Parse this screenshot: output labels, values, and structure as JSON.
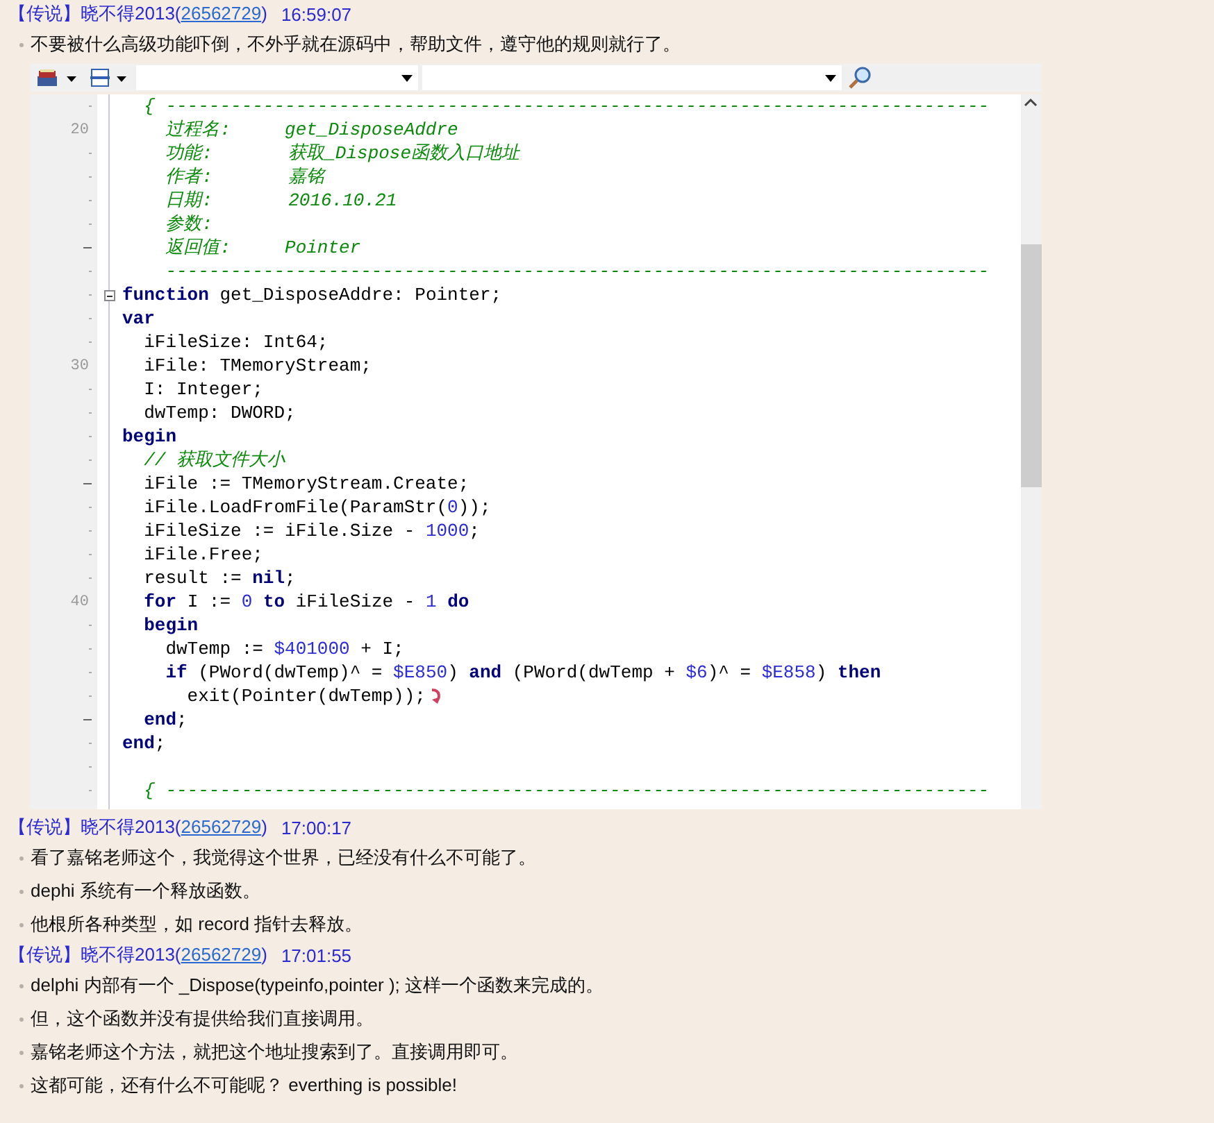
{
  "messages": [
    {
      "sender": {
        "prefix": "【传说】晓不得2013(",
        "qq": "26562729",
        "suffix": ")"
      },
      "time": "16:59:07",
      "items": [
        {
          "kind": "text",
          "text": "不要被什么高级功能吓倒，不外乎就在源码中，帮助文件，遵守他的规则就行了。"
        },
        {
          "kind": "code",
          "lines": [
            {
              "kind": "code",
              "tokens": [
                {
                  "kind": "comment",
                  "text": "  { ----------------------------------------------------------------------------"
                }
              ]
            },
            {
              "kind": "code",
              "number": "20",
              "tokens": [
                {
                  "kind": "comment",
                  "text": "    过程名:     get_DisposeAddre"
                }
              ]
            },
            {
              "kind": "code",
              "tokens": [
                {
                  "kind": "comment",
                  "text": "    功能:       获取_Dispose函数入口地址"
                }
              ]
            },
            {
              "kind": "code",
              "tokens": [
                {
                  "kind": "comment",
                  "text": "    作者:       嘉铭"
                }
              ]
            },
            {
              "kind": "code",
              "tokens": [
                {
                  "kind": "comment",
                  "text": "    日期:       2016.10.21"
                }
              ]
            },
            {
              "kind": "code",
              "tokens": [
                {
                  "kind": "comment",
                  "text": "    参数:"
                }
              ]
            },
            {
              "kind": "code",
              "block_end": true,
              "tokens": [
                {
                  "kind": "comment",
                  "text": "    返回值:     Pointer"
                }
              ]
            },
            {
              "kind": "code",
              "tokens": [
                {
                  "kind": "comment",
                  "text": "    ----------------------------------------------------------------------------"
                }
              ]
            },
            {
              "kind": "code",
              "collapsible": true,
              "tokens": [
                {
                  "kind": "keyword",
                  "text": "function"
                },
                {
                  "kind": "plain",
                  "text": " get_DisposeAddre: Pointer;"
                }
              ]
            },
            {
              "kind": "code",
              "tokens": [
                {
                  "kind": "keyword",
                  "text": "var"
                }
              ]
            },
            {
              "kind": "code",
              "tokens": [
                {
                  "kind": "plain",
                  "text": "  iFileSize: Int64;"
                }
              ]
            },
            {
              "kind": "code",
              "number": "30",
              "tokens": [
                {
                  "kind": "plain",
                  "text": "  iFile: TMemoryStream;"
                }
              ]
            },
            {
              "kind": "code",
              "tokens": [
                {
                  "kind": "plain",
                  "text": "  I: Integer;"
                }
              ]
            },
            {
              "kind": "code",
              "tokens": [
                {
                  "kind": "plain",
                  "text": "  dwTemp: DWORD;"
                }
              ]
            },
            {
              "kind": "code",
              "tokens": [
                {
                  "kind": "keyword",
                  "text": "begin"
                }
              ]
            },
            {
              "kind": "code",
              "tokens": [
                {
                  "kind": "comment",
                  "text": "  // 获取文件大小"
                }
              ]
            },
            {
              "kind": "code",
              "block_end": true,
              "tokens": [
                {
                  "kind": "plain",
                  "text": "  iFile := TMemoryStream.Create;"
                }
              ]
            },
            {
              "kind": "code",
              "tokens": [
                {
                  "kind": "plain",
                  "text": "  iFile.LoadFromFile(ParamStr("
                },
                {
                  "kind": "number",
                  "text": "0"
                },
                {
                  "kind": "plain",
                  "text": "));"
                }
              ]
            },
            {
              "kind": "code",
              "tokens": [
                {
                  "kind": "plain",
                  "text": "  iFileSize := iFile.Size - "
                },
                {
                  "kind": "number",
                  "text": "1000"
                },
                {
                  "kind": "plain",
                  "text": ";"
                }
              ]
            },
            {
              "kind": "code",
              "tokens": [
                {
                  "kind": "plain",
                  "text": "  iFile.Free;"
                }
              ]
            },
            {
              "kind": "code",
              "tokens": [
                {
                  "kind": "plain",
                  "text": "  result := "
                },
                {
                  "kind": "keyword",
                  "text": "nil"
                },
                {
                  "kind": "plain",
                  "text": ";"
                }
              ]
            },
            {
              "kind": "code",
              "number": "40",
              "tokens": [
                {
                  "kind": "keyword",
                  "text": "  for"
                },
                {
                  "kind": "plain",
                  "text": " I := "
                },
                {
                  "kind": "number",
                  "text": "0"
                },
                {
                  "kind": "keyword",
                  "text": " to"
                },
                {
                  "kind": "plain",
                  "text": " iFileSize - "
                },
                {
                  "kind": "number",
                  "text": "1"
                },
                {
                  "kind": "keyword",
                  "text": " do"
                }
              ]
            },
            {
              "kind": "code",
              "tokens": [
                {
                  "kind": "keyword",
                  "text": "  begin"
                }
              ]
            },
            {
              "kind": "code",
              "tokens": [
                {
                  "kind": "plain",
                  "text": "    dwTemp := "
                },
                {
                  "kind": "number",
                  "text": "$401000"
                },
                {
                  "kind": "plain",
                  "text": " + I;"
                }
              ]
            },
            {
              "kind": "code",
              "tokens": [
                {
                  "kind": "keyword",
                  "text": "    if"
                },
                {
                  "kind": "plain",
                  "text": " (PWord(dwTemp)^ = "
                },
                {
                  "kind": "number",
                  "text": "$E850"
                },
                {
                  "kind": "plain",
                  "text": ") "
                },
                {
                  "kind": "keyword",
                  "text": "and"
                },
                {
                  "kind": "plain",
                  "text": " (PWord(dwTemp + "
                },
                {
                  "kind": "number",
                  "text": "$6"
                },
                {
                  "kind": "plain",
                  "text": ")^ = "
                },
                {
                  "kind": "number",
                  "text": "$E858"
                },
                {
                  "kind": "plain",
                  "text": ") "
                },
                {
                  "kind": "keyword",
                  "text": "then"
                }
              ]
            },
            {
              "kind": "code",
              "return_mark": true,
              "tokens": [
                {
                  "kind": "plain",
                  "text": "      exit(Pointer(dwTemp));"
                }
              ]
            },
            {
              "kind": "code",
              "block_end": true,
              "tokens": [
                {
                  "kind": "keyword",
                  "text": "  end"
                },
                {
                  "kind": "plain",
                  "text": ";"
                }
              ]
            },
            {
              "kind": "code",
              "tokens": [
                {
                  "kind": "keyword",
                  "text": "end"
                },
                {
                  "kind": "plain",
                  "text": ";"
                }
              ]
            },
            {
              "kind": "blank"
            },
            {
              "kind": "code",
              "tokens": [
                {
                  "kind": "comment",
                  "text": "  { ----------------------------------------------------------------------------"
                }
              ]
            }
          ]
        }
      ]
    },
    {
      "sender": {
        "prefix": "【传说】晓不得2013(",
        "qq": "26562729",
        "suffix": ")"
      },
      "time": "17:00:17",
      "items": [
        {
          "kind": "text",
          "text": "看了嘉铭老师这个，我觉得这个世界，已经没有什么不可能了。"
        },
        {
          "kind": "text",
          "text": "dephi 系统有一个释放函数。"
        },
        {
          "kind": "text",
          "text": "他根所各种类型，如 record 指针去释放。"
        }
      ]
    },
    {
      "sender": {
        "prefix": "【传说】晓不得2013(",
        "qq": "26562729",
        "suffix": ")"
      },
      "time": "17:01:55",
      "items": [
        {
          "kind": "text",
          "text": "delphi 内部有一个 _Dispose(typeinfo,pointer ); 这样一个函数来完成的。"
        },
        {
          "kind": "text",
          "text": "但，这个函数并没有提供给我们直接调用。"
        },
        {
          "kind": "text",
          "text": "嘉铭老师这个方法，就把这个地址搜索到了。直接调用即可。"
        },
        {
          "kind": "text",
          "text": "这都可能，还有什么不可能呢？ everthing is possible!"
        }
      ]
    }
  ]
}
